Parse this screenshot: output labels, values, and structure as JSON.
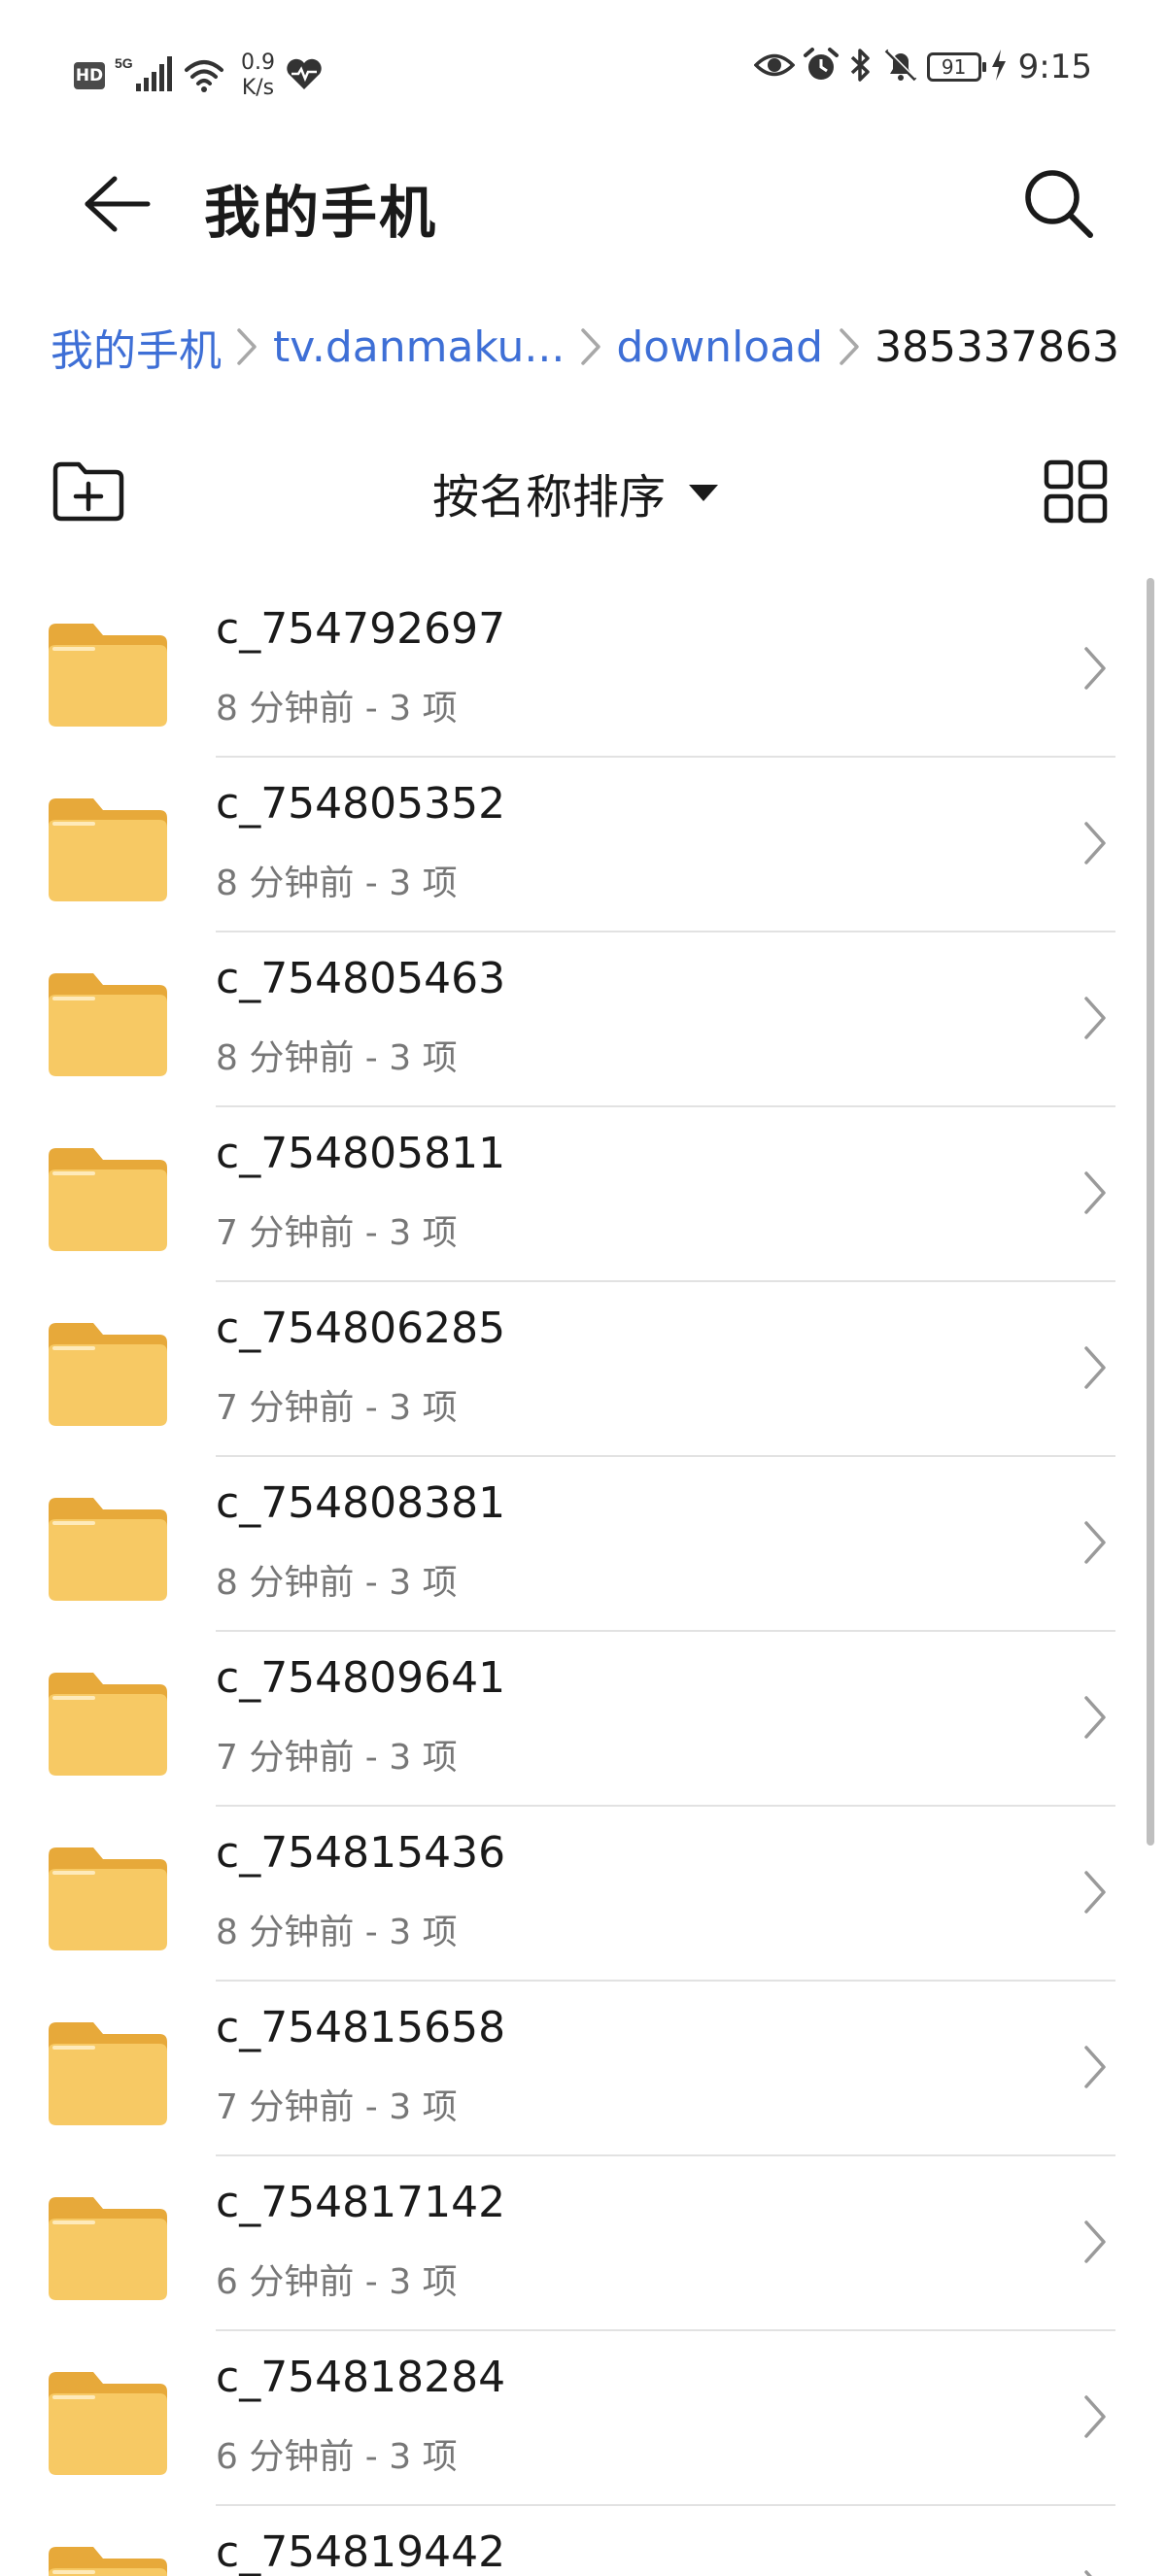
{
  "status_bar": {
    "hd": "HD",
    "signal_label": "5G",
    "speed_value": "0.9",
    "speed_unit": "K/s",
    "battery_level": "91",
    "time": "9:15"
  },
  "header": {
    "title": "我的手机"
  },
  "breadcrumb": [
    {
      "label": "我的手机",
      "current": false
    },
    {
      "label": "tv.danmaku...",
      "current": false
    },
    {
      "label": "download",
      "current": false
    },
    {
      "label": "385337863",
      "current": true
    }
  ],
  "toolbar": {
    "sort_label": "按名称排序"
  },
  "colors": {
    "accent": "#3e6fd6",
    "folder_front": "#f7c964",
    "folder_back": "#e7a93a",
    "meta_text": "#777777"
  },
  "files": [
    {
      "name": "c_754792697",
      "meta": "8 分钟前 - 3 项"
    },
    {
      "name": "c_754805352",
      "meta": "8 分钟前 - 3 项"
    },
    {
      "name": "c_754805463",
      "meta": "8 分钟前 - 3 项"
    },
    {
      "name": "c_754805811",
      "meta": "7 分钟前 - 3 项"
    },
    {
      "name": "c_754806285",
      "meta": "7 分钟前 - 3 项"
    },
    {
      "name": "c_754808381",
      "meta": "8 分钟前 - 3 项"
    },
    {
      "name": "c_754809641",
      "meta": "7 分钟前 - 3 项"
    },
    {
      "name": "c_754815436",
      "meta": "8 分钟前 - 3 项"
    },
    {
      "name": "c_754815658",
      "meta": "7 分钟前 - 3 项"
    },
    {
      "name": "c_754817142",
      "meta": "6 分钟前 - 3 项"
    },
    {
      "name": "c_754818284",
      "meta": "6 分钟前 - 3 项"
    },
    {
      "name": "c_754819442",
      "meta": ""
    }
  ]
}
